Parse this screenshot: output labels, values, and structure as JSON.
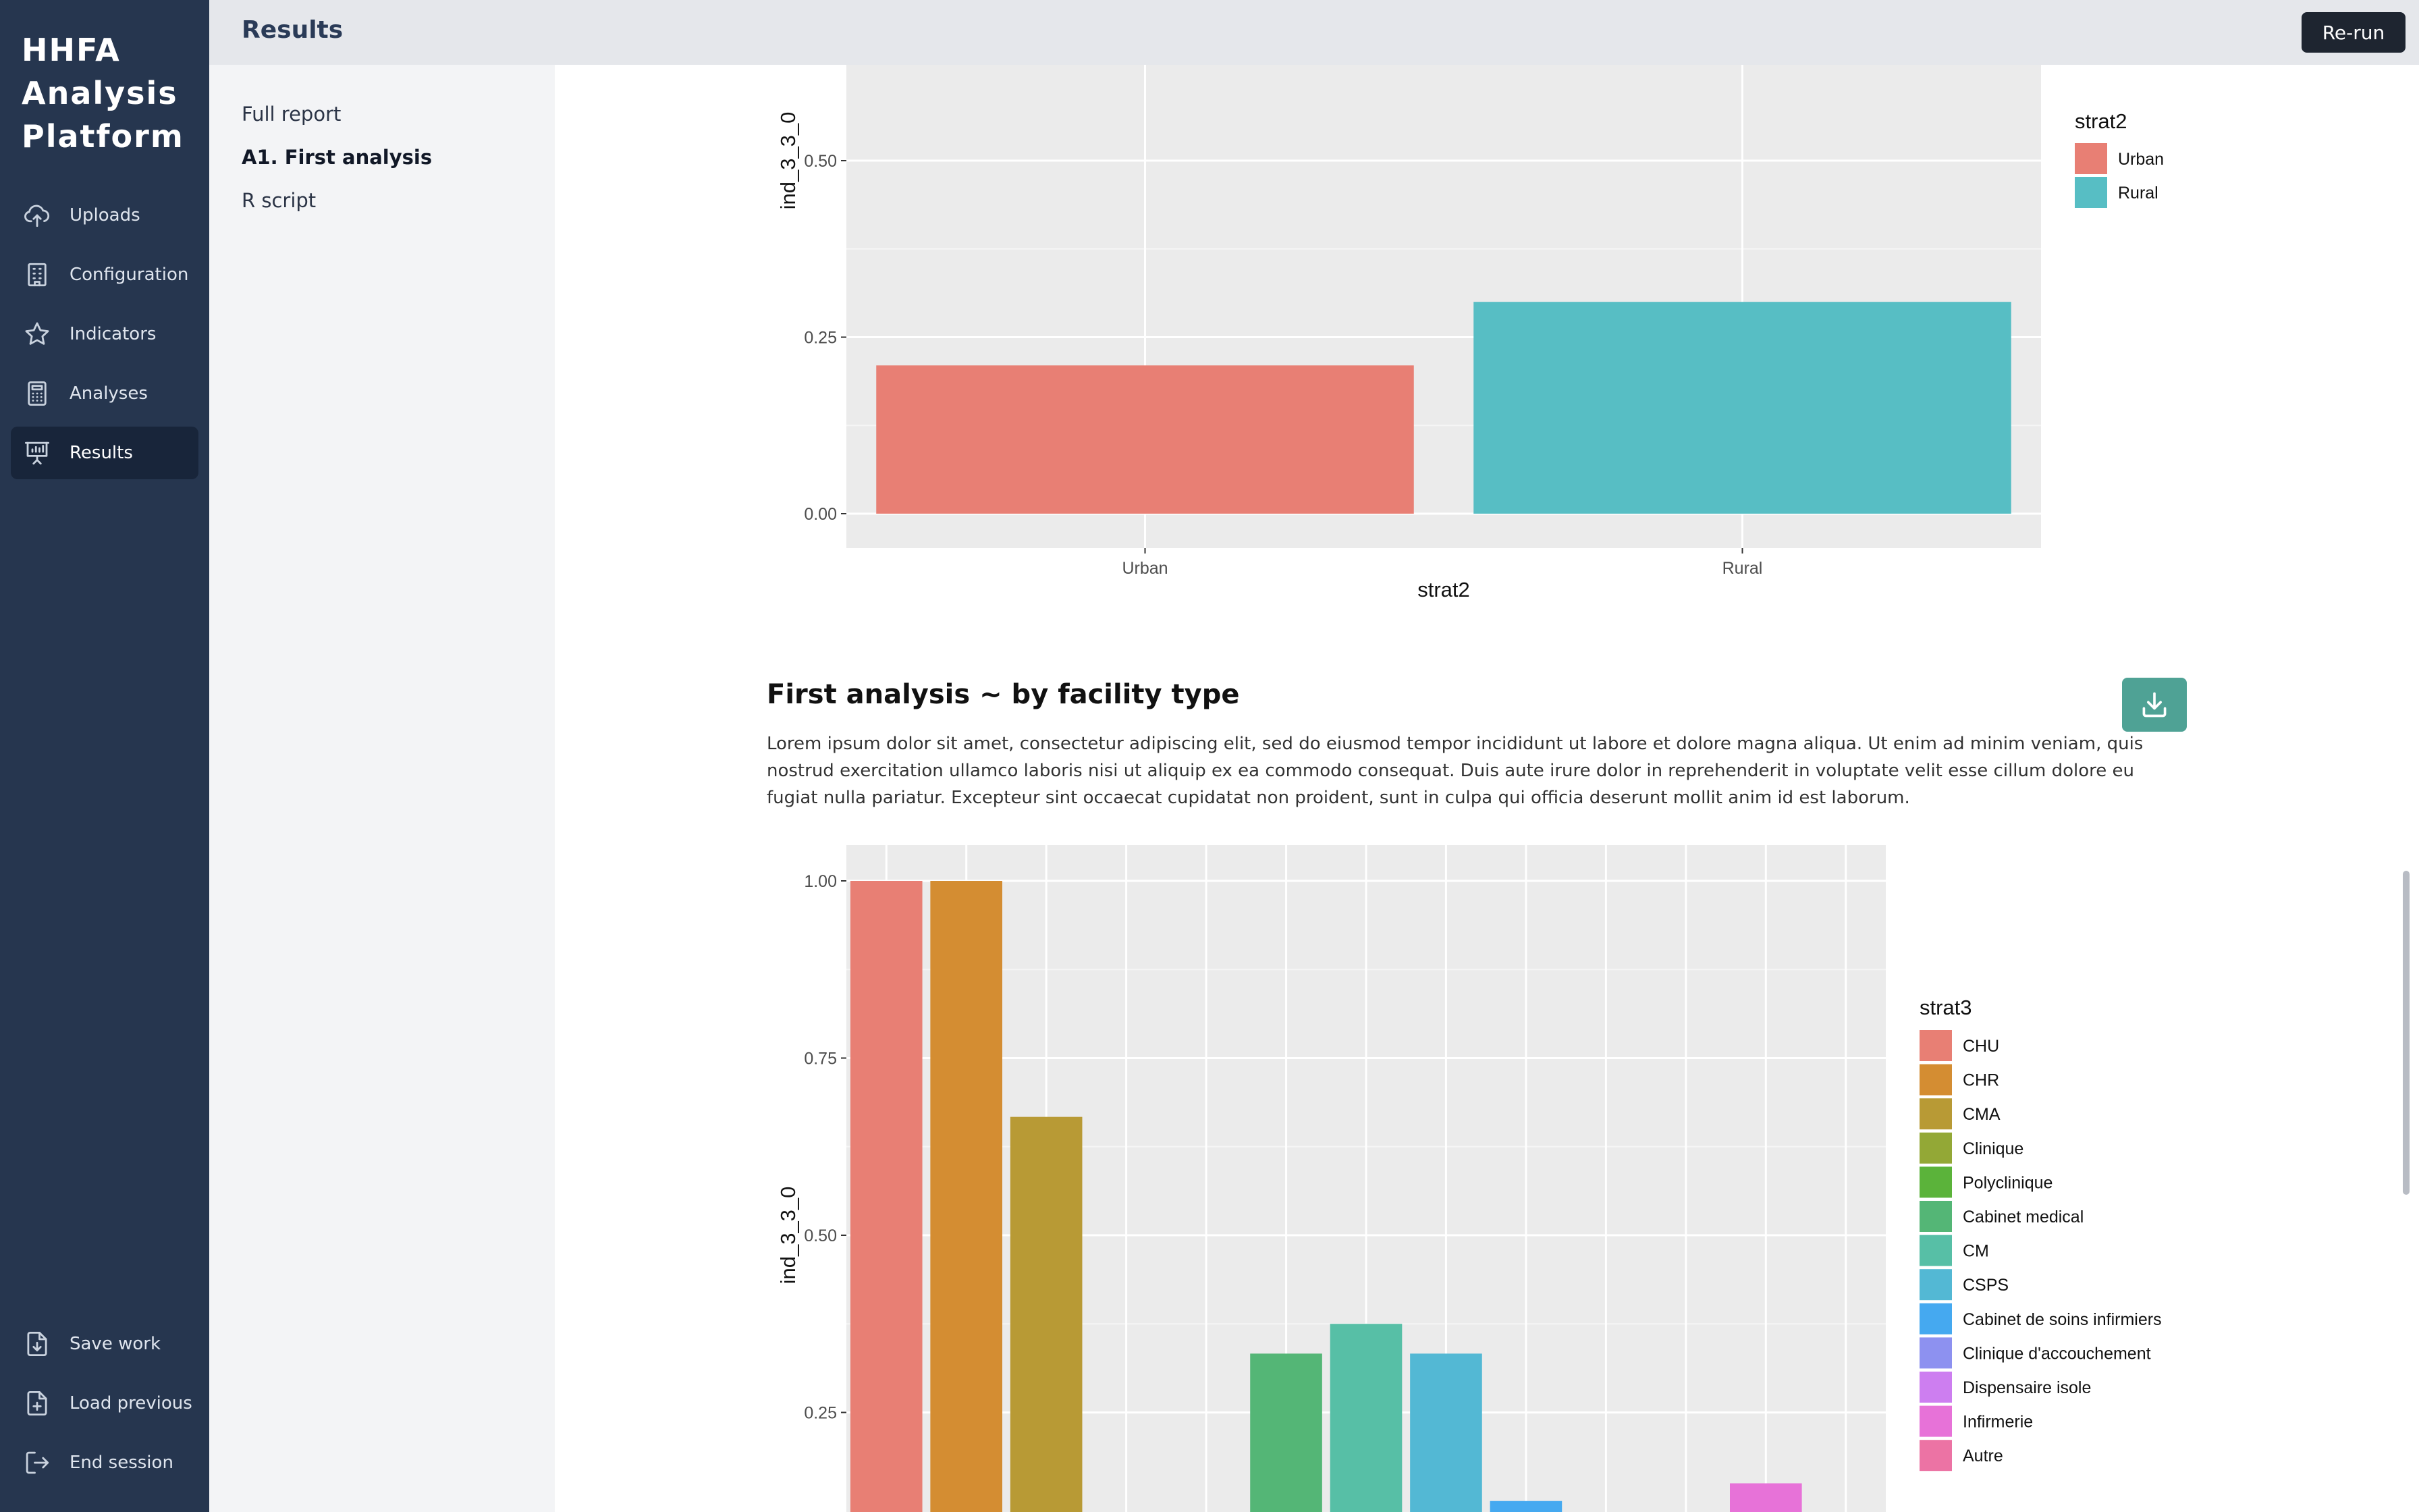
{
  "app": {
    "brand_line1": "HHFA",
    "brand_line2": "Analysis",
    "brand_line3": "Platform"
  },
  "sidebar": {
    "items": [
      {
        "label": "Uploads",
        "icon": "upload-cloud-icon"
      },
      {
        "label": "Configuration",
        "icon": "building-icon"
      },
      {
        "label": "Indicators",
        "icon": "star-icon"
      },
      {
        "label": "Analyses",
        "icon": "calculator-icon"
      },
      {
        "label": "Results",
        "icon": "presentation-chart-icon",
        "active": true
      }
    ],
    "footer": [
      {
        "label": "Save work",
        "icon": "file-download-icon"
      },
      {
        "label": "Load previous",
        "icon": "file-plus-icon"
      },
      {
        "label": "End session",
        "icon": "logout-icon"
      }
    ]
  },
  "header": {
    "title": "Results",
    "rerun_label": "Re-run"
  },
  "subnav": {
    "items": [
      "Full report",
      "A1. First analysis",
      "R script"
    ]
  },
  "section2": {
    "title": "First analysis ~ by facility type",
    "paragraph": "Lorem ipsum dolor sit amet, consectetur adipiscing elit, sed do eiusmod tempor incididunt ut labore et dolore magna aliqua. Ut enim ad minim veniam, quis nostrud exercitation ullamco laboris nisi ut aliquip ex ea commodo consequat. Duis aute irure dolor in reprehenderit in voluptate velit esse cillum dolore eu fugiat nulla pariatur. Excepteur sint occaecat cupidatat non proident, sunt in culpa qui officia deserunt mollit anim id est laborum."
  },
  "chart_data": [
    {
      "type": "bar",
      "categories": [
        "Urban",
        "Rural"
      ],
      "values": [
        0.21,
        0.3
      ],
      "colors": [
        "#e87f74",
        "#57bec4"
      ],
      "xlabel": "strat2",
      "ylabel": "ind_3_3_0",
      "yticks": [
        "0.00",
        "0.25",
        "0.50"
      ],
      "legend_title": "strat2",
      "legend_position": "right",
      "grid": true
    },
    {
      "type": "bar",
      "categories": [
        "CHU",
        "CHR",
        "CMA",
        "Clinique",
        "Polyclinique",
        "Cabinet medical",
        "CM",
        "CSPS",
        "Cabinet de soins infirmiers",
        "Clinique d'accouchement",
        "Dispensaire isole",
        "Infirmerie",
        "Autre"
      ],
      "values": [
        1.0,
        1.0,
        0.667,
        null,
        null,
        0.333,
        0.375,
        0.333,
        0.125,
        null,
        null,
        0.15,
        null
      ],
      "colors": [
        "#e87f74",
        "#d48d32",
        "#b89a35",
        "#93a836",
        "#5bb33a",
        "#54b676",
        "#57bfa6",
        "#53b8d4",
        "#45a9f0",
        "#8d91f0",
        "#cd7ef0",
        "#e772d8",
        "#ec73a4"
      ],
      "ylabel": "ind_3_3_0",
      "yticks": [
        "0.25",
        "0.50",
        "0.75",
        "1.00"
      ],
      "legend_title": "strat3",
      "legend_position": "right",
      "grid": true
    }
  ]
}
